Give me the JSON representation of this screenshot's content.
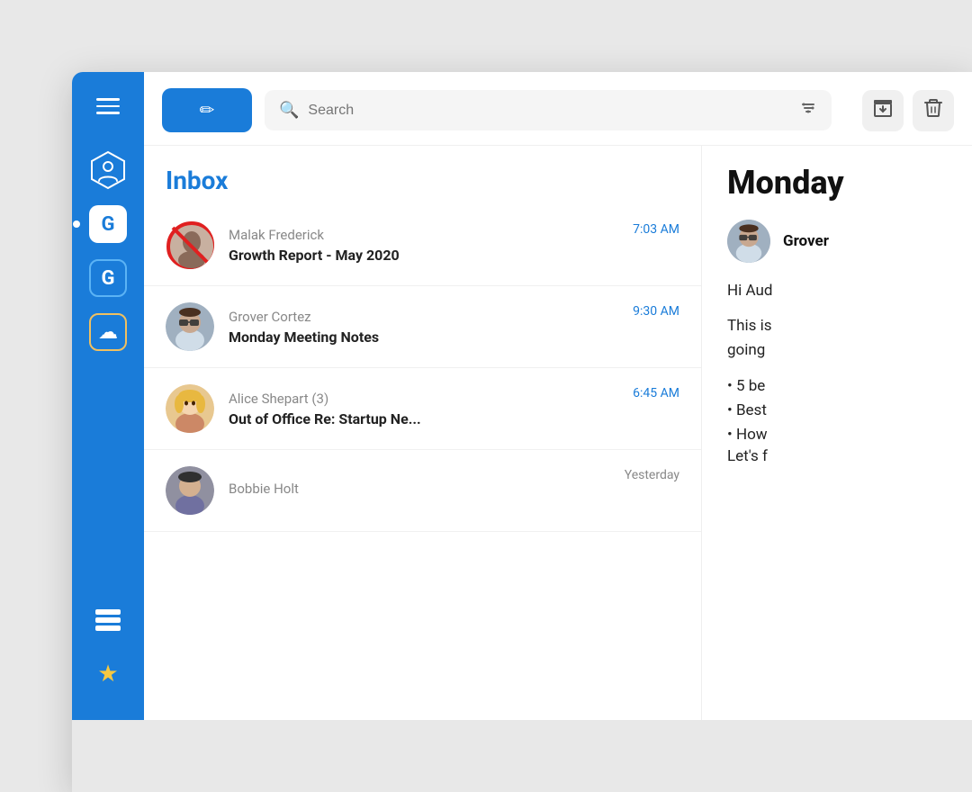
{
  "sidebar": {
    "hamburger_label": "Menu",
    "icons": [
      {
        "name": "user-circle-icon",
        "type": "hex",
        "label": "User"
      },
      {
        "name": "g-solid-icon",
        "type": "g-solid",
        "label": "G App",
        "active": true
      },
      {
        "name": "g-outline-icon",
        "type": "g-outline",
        "label": "G Outlined"
      },
      {
        "name": "cloud-icon",
        "type": "cloud",
        "label": "Cloud"
      },
      {
        "name": "stack-icon",
        "type": "stack",
        "label": "Stack"
      },
      {
        "name": "star-icon",
        "type": "star",
        "label": "Favorites"
      }
    ]
  },
  "toolbar": {
    "compose_label": "✏",
    "search_placeholder": "Search",
    "archive_icon": "archive",
    "delete_icon": "trash"
  },
  "email_list": {
    "title": "Inbox",
    "emails": [
      {
        "id": "email-1",
        "sender": "Malak Frederick",
        "subject": "Growth Report - May 2020",
        "time": "7:03 AM",
        "time_type": "today",
        "avatar_type": "banned"
      },
      {
        "id": "email-2",
        "sender": "Grover Cortez",
        "subject": "Monday Meeting Notes",
        "time": "9:30 AM",
        "time_type": "today",
        "avatar_type": "grover"
      },
      {
        "id": "email-3",
        "sender": "Alice Shepart (3)",
        "subject": "Out of Office Re: Startup Ne...",
        "time": "6:45 AM",
        "time_type": "today",
        "avatar_type": "alice"
      },
      {
        "id": "email-4",
        "sender": "Bobbie Holt",
        "subject": "",
        "time": "Yesterday",
        "time_type": "yesterday",
        "avatar_type": "bobbie"
      }
    ]
  },
  "preview": {
    "day_label": "Monday",
    "sender_name": "Grover",
    "greeting": "Hi Aud",
    "body_line1": "This is",
    "body_line2": "going",
    "bullets": [
      "5 be",
      "Best",
      "How"
    ],
    "closing": "Let's f"
  }
}
